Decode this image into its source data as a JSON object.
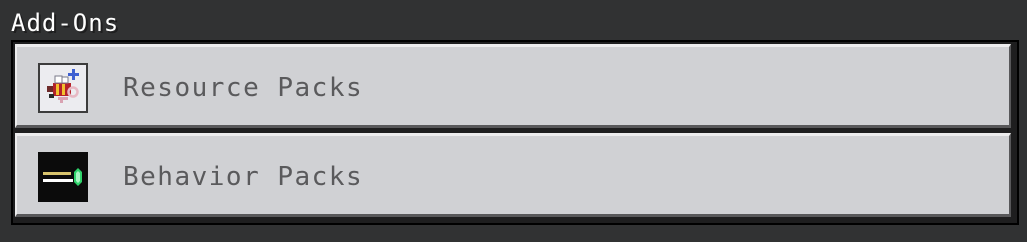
{
  "header": {
    "title": "Add-Ons"
  },
  "packs": [
    {
      "label": "Resource Packs",
      "icon": "resource-pack-icon"
    },
    {
      "label": "Behavior Packs",
      "icon": "behavior-pack-icon"
    }
  ],
  "colors": {
    "background": "#313233",
    "row": "#d0d1d4",
    "label": "#5a5a5c",
    "title": "#ffffff"
  }
}
